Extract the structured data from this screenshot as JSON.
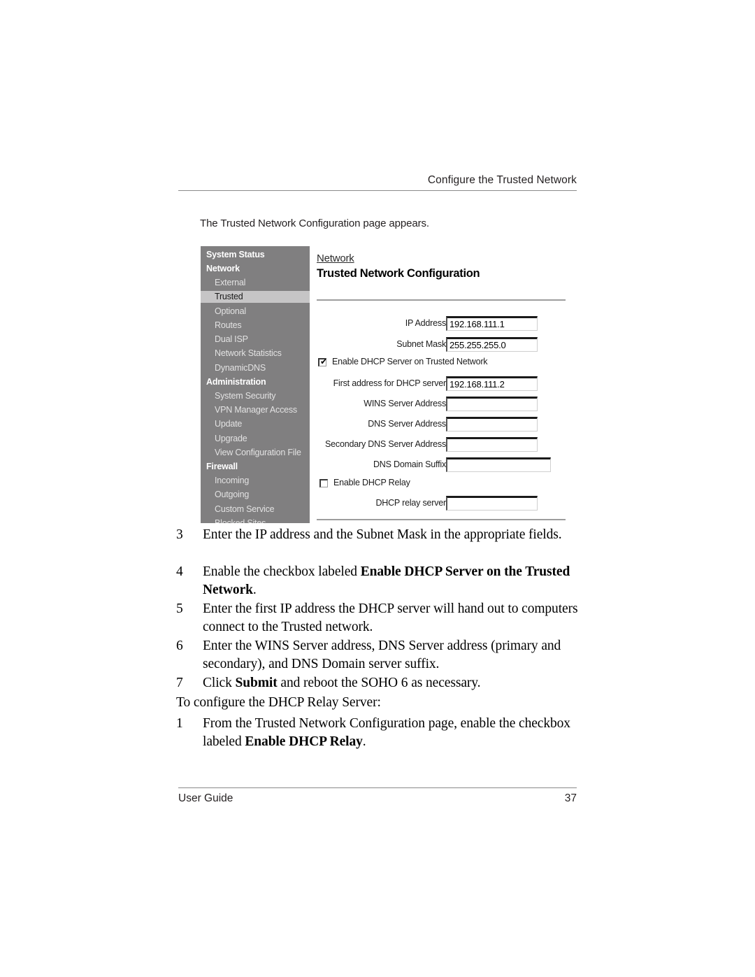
{
  "page": {
    "running_head": "Configure the Trusted Network",
    "intro": "The Trusted Network Configuration page appears.",
    "footer_left": "User Guide",
    "footer_page_number": "37"
  },
  "screenshot": {
    "sidebar": {
      "entries": [
        {
          "label": "System Status",
          "type": "group"
        },
        {
          "label": "Network",
          "type": "group"
        },
        {
          "label": "External",
          "type": "item"
        },
        {
          "label": "Trusted",
          "type": "item",
          "selected": true
        },
        {
          "label": "Optional",
          "type": "item"
        },
        {
          "label": "Routes",
          "type": "item"
        },
        {
          "label": "Dual ISP",
          "type": "item"
        },
        {
          "label": "Network Statistics",
          "type": "item"
        },
        {
          "label": "DynamicDNS",
          "type": "item"
        },
        {
          "label": "Administration",
          "type": "group"
        },
        {
          "label": "System Security",
          "type": "item"
        },
        {
          "label": "VPN Manager Access",
          "type": "item"
        },
        {
          "label": "Update",
          "type": "item"
        },
        {
          "label": "Upgrade",
          "type": "item"
        },
        {
          "label": "View Configuration File",
          "type": "item"
        },
        {
          "label": "Firewall",
          "type": "group"
        },
        {
          "label": "Incoming",
          "type": "item"
        },
        {
          "label": "Outgoing",
          "type": "item"
        },
        {
          "label": "Custom Service",
          "type": "item"
        },
        {
          "label": "Blocked Sites",
          "type": "item"
        }
      ]
    },
    "panel": {
      "breadcrumb": "Network",
      "title": "Trusted Network Configuration",
      "fields": [
        {
          "label": "IP Address",
          "value": "192.168.111.1"
        },
        {
          "label": "Subnet Mask",
          "value": "255.255.255.0"
        },
        {
          "label": "First address for DHCP server",
          "value": "192.168.111.2"
        },
        {
          "label": "WINS Server Address",
          "value": ""
        },
        {
          "label": "DNS Server Address",
          "value": ""
        },
        {
          "label": "Secondary DNS Server Address",
          "value": ""
        },
        {
          "label": "DNS Domain Suffix",
          "value": ""
        },
        {
          "label": "DHCP relay server",
          "value": ""
        }
      ],
      "checkboxes": [
        {
          "label": "Enable DHCP Server on Trusted Network",
          "checked": true,
          "mark": "✔"
        },
        {
          "label": "Enable DHCP Relay",
          "checked": false,
          "mark": ""
        }
      ]
    },
    "colors": {
      "sidebar_bg": "#807f80",
      "selected_bg": "#c6c5c6",
      "panel_bg": "#ffffff",
      "rule": "#9d9d9d"
    }
  },
  "steps": [
    {
      "num": "3",
      "html": "Enter the IP address and the Subnet Mask in the appropriate fields."
    },
    {
      "num": "4",
      "html": "Enable the checkbox labeled <b>Enable DHCP Server on the Trusted Network</b>."
    },
    {
      "num": "5",
      "html": "Enter the first IP address the DHCP server will hand out to computers connect to the Trusted network."
    },
    {
      "num": "6",
      "html": "Enter the WINS Server address, DNS Server address (primary and secondary), and DNS Domain server suffix."
    },
    {
      "num": "7",
      "html": "Click <b>Submit</b> and reboot the SOHO 6 as necessary."
    }
  ],
  "relay_section": {
    "lead_in": "To configure the DHCP Relay Server:",
    "steps": [
      {
        "num": "1",
        "html": "From the Trusted Network Configuration page, enable the checkbox labeled <b>Enable DHCP Relay</b>."
      }
    ]
  }
}
